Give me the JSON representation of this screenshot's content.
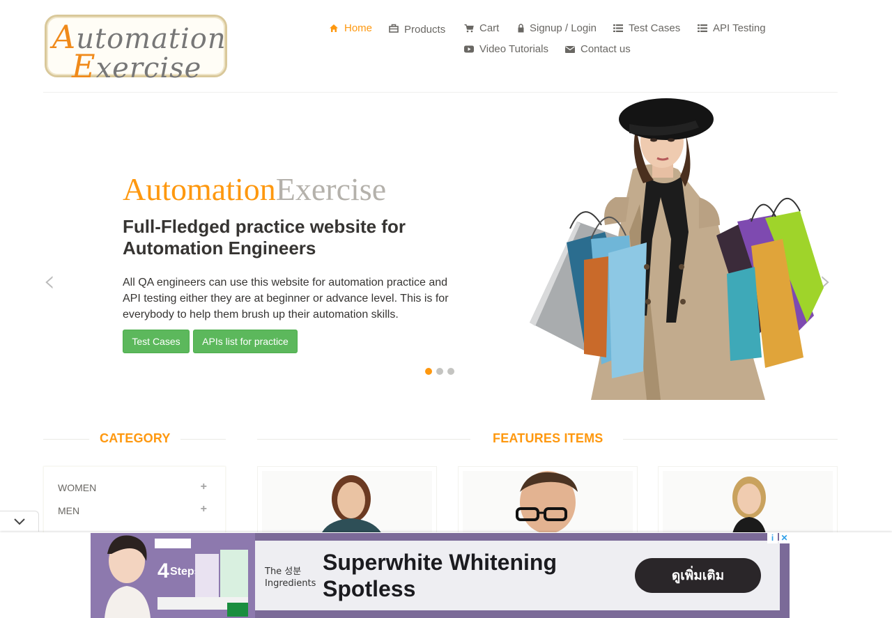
{
  "header": {
    "logo_line1_cap": "A",
    "logo_line1_rest": "utomation",
    "logo_line2_cap": "E",
    "logo_line2_rest": "xercise",
    "nav": [
      {
        "label": "Home",
        "icon": "home-icon",
        "active": true
      },
      {
        "label": "Products",
        "icon": "shopping-bag-icon"
      },
      {
        "label": "Cart",
        "icon": "cart-icon"
      },
      {
        "label": "Signup / Login",
        "icon": "lock-icon"
      },
      {
        "label": "Test Cases",
        "icon": "list-icon"
      },
      {
        "label": "API Testing",
        "icon": "list-icon"
      },
      {
        "label": "Video Tutorials",
        "icon": "youtube-play-icon"
      },
      {
        "label": "Contact us",
        "icon": "envelope-icon"
      }
    ]
  },
  "slider": {
    "brand_a": "Automation",
    "brand_b": "Exercise",
    "headline": "Full-Fledged practice website for Automation Engineers",
    "description": "All QA engineers can use this website for automation practice and API testing either they are at beginner or advance level. This is for everybody to help them brush up their automation skills.",
    "btn_test_cases": "Test Cases",
    "btn_apis": "APIs list for practice",
    "prev_glyph": "‹",
    "next_glyph": "›",
    "active_slide": 1,
    "slide_count": 3
  },
  "sidebar": {
    "title": "CATEGORY",
    "categories": [
      {
        "label": "WOMEN"
      },
      {
        "label": "MEN"
      }
    ]
  },
  "features": {
    "title": "FEATURES ITEMS"
  },
  "ad": {
    "brand": "The 성분\nIngredients",
    "headline_line1": "Superwhite Whitening",
    "headline_line2": "Spotless",
    "cta": "ดูเพิ่มเติม",
    "info_glyph": "i",
    "close_glyph": "✕",
    "collapse_glyph": "⌄"
  },
  "colors": {
    "accent": "#fe980f",
    "button_green": "#5cb85c",
    "text": "#696763",
    "dark": "#363432"
  }
}
